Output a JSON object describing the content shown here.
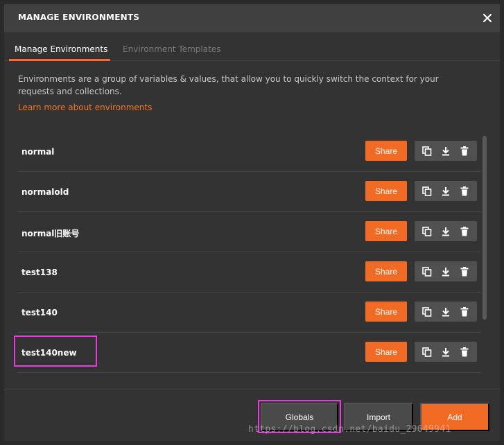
{
  "header": {
    "title": "MANAGE ENVIRONMENTS"
  },
  "tabs": [
    {
      "label": "Manage Environments",
      "active": true
    },
    {
      "label": "Environment Templates",
      "active": false
    }
  ],
  "description": "Environments are a group of variables & values, that allow you to quickly switch the context for your requests and collections.",
  "learn_link": "Learn more about environments",
  "environments": [
    {
      "name": "normal",
      "share_label": "Share"
    },
    {
      "name": "normalold",
      "share_label": "Share"
    },
    {
      "name": "normal旧账号",
      "share_label": "Share"
    },
    {
      "name": "test138",
      "share_label": "Share"
    },
    {
      "name": "test140",
      "share_label": "Share"
    },
    {
      "name": "test140new",
      "share_label": "Share"
    }
  ],
  "footer": {
    "globals_label": "Globals",
    "import_label": "Import",
    "add_label": "Add"
  },
  "watermark": "https://blog.csdn.net/baidu_29649941",
  "colors": {
    "accent": "#f26b25",
    "highlight": "#e53be0",
    "background": "#333333"
  },
  "icons": [
    "close-icon",
    "duplicate-icon",
    "download-icon",
    "trash-icon"
  ]
}
